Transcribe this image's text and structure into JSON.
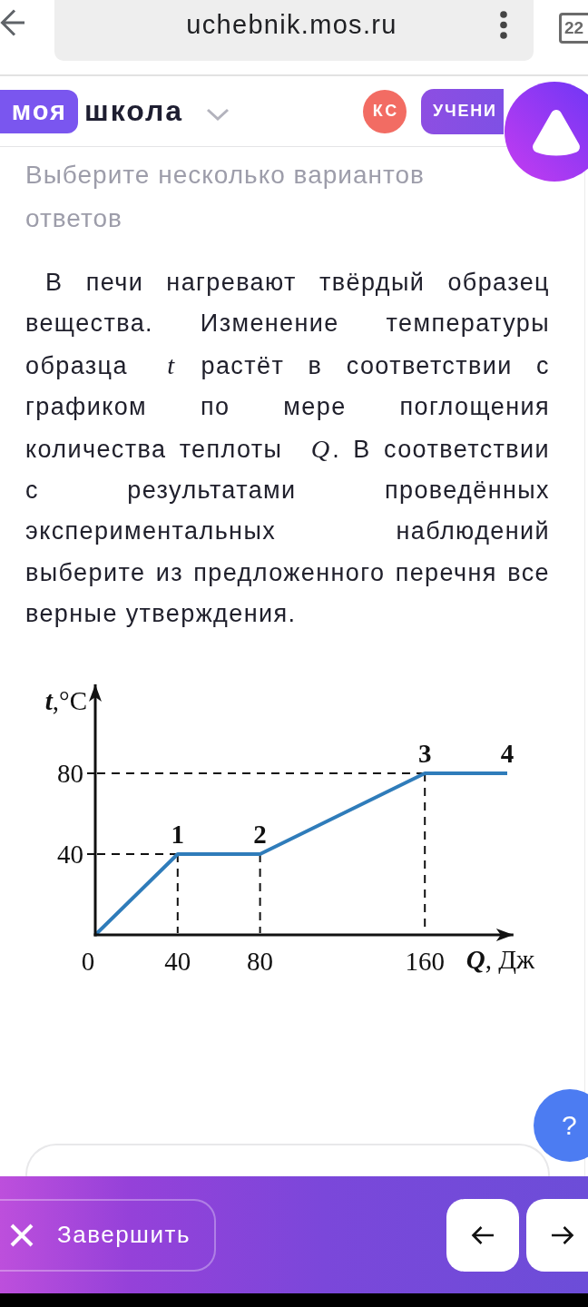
{
  "browser": {
    "url": "uchebnik.mos.ru",
    "tab_count": "22"
  },
  "header": {
    "logo_badge": "моя",
    "logo_text": "школа",
    "avatar_initials": "КС",
    "role_button": "УЧЕНИ"
  },
  "task": {
    "instruction": "Выберите несколько вариантов ответов",
    "question": "В печи нагревают твёрдый образец вещества. Изменение температуры образца *t* растёт в соответствии с графиком по мере поглощения количества теплоты *Q*. В соответствии с результатами проведённых экспериментальных наблюдений выберите из предложенного перечня все верные утверждения.",
    "chart_data": {
      "type": "line",
      "xlabel": "*Q*, Дж",
      "ylabel": "*t*,°C",
      "x": [
        0,
        40,
        80,
        160,
        200
      ],
      "series": [
        {
          "color": "#2f7cba",
          "values": [
            0,
            40,
            40,
            80,
            80
          ]
        }
      ],
      "xlim": [
        0,
        203
      ],
      "ylim": [
        0,
        124
      ],
      "xticks": [
        0,
        40,
        80,
        160
      ],
      "yticks": [
        40,
        80
      ],
      "value_labels": [
        null,
        "1",
        "2",
        "3",
        "4"
      ]
    }
  },
  "help_button": "?",
  "footer": {
    "finish_button": "Завершить"
  }
}
